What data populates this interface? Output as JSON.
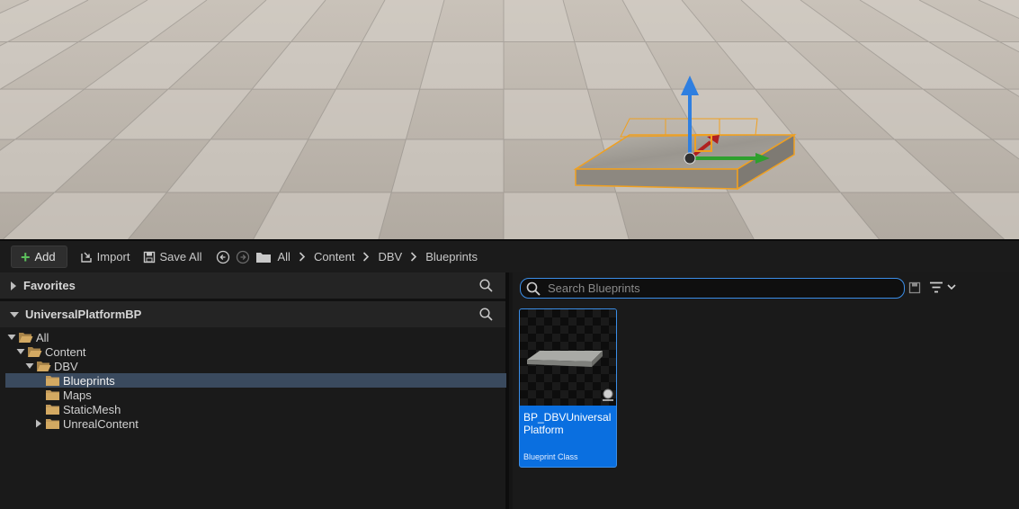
{
  "toolbar": {
    "add_label": "Add",
    "import_label": "Import",
    "save_all_label": "Save All"
  },
  "breadcrumb": [
    "All",
    "Content",
    "DBV",
    "Blueprints"
  ],
  "left_panel": {
    "favorites_label": "Favorites",
    "collection_label": "UniversalPlatformBP",
    "tree": [
      {
        "label": "All",
        "depth": 0,
        "expanded": true,
        "selected": false
      },
      {
        "label": "Content",
        "depth": 1,
        "expanded": true,
        "selected": false
      },
      {
        "label": "DBV",
        "depth": 2,
        "expanded": true,
        "selected": false
      },
      {
        "label": "Blueprints",
        "depth": 3,
        "expanded": false,
        "selected": true
      },
      {
        "label": "Maps",
        "depth": 3,
        "expanded": false,
        "selected": false
      },
      {
        "label": "StaticMesh",
        "depth": 3,
        "expanded": false,
        "selected": false
      },
      {
        "label": "UnrealContent",
        "depth": 3,
        "collapsed_children": true,
        "selected": false
      }
    ]
  },
  "right_panel": {
    "search_placeholder": "Search Blueprints",
    "asset": {
      "name": "BP_DBVUniversalPlatform",
      "type": "Blueprint Class"
    }
  },
  "colors": {
    "selection_blue": "#0a6fe0",
    "focus_blue": "#3b8ee8",
    "folder": "#c29a5b",
    "add_green": "#5cc05c",
    "gizmo_x": "#2ea02e",
    "gizmo_z": "#2f7fe0",
    "selection_outline": "#f0a020"
  }
}
